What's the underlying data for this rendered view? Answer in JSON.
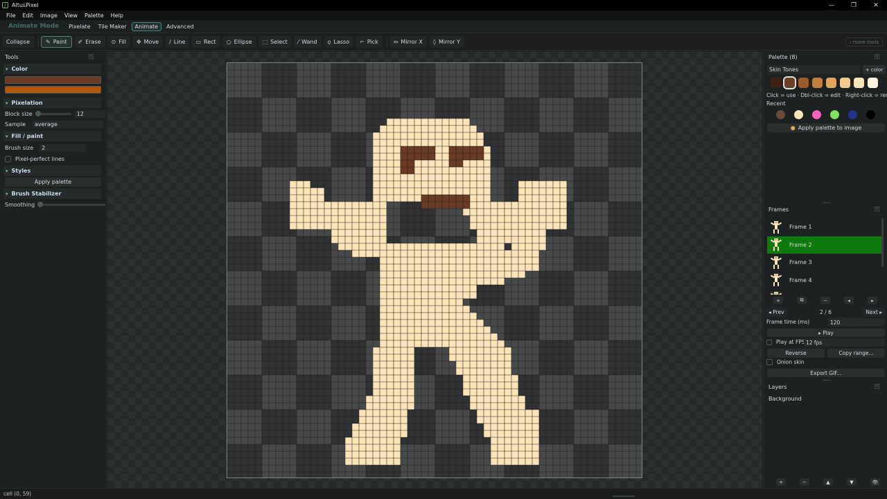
{
  "app": {
    "title": "AltusPixel",
    "icon": "app-logo-icon"
  },
  "window": {
    "minimize": "—",
    "restore": "❐",
    "close": "✕"
  },
  "menu": [
    "File",
    "Edit",
    "Image",
    "View",
    "Palette",
    "Help"
  ],
  "modebar": {
    "label": "Animate Mode",
    "tabs": [
      "Pixelate",
      "Tile Maker",
      "Animate",
      "Advanced"
    ],
    "active_tab": "Animate"
  },
  "toolbar": {
    "collapse": "Collapse",
    "tools": [
      {
        "label": "Paint",
        "icon": "✎"
      },
      {
        "label": "Erase",
        "icon": "✐"
      },
      {
        "label": "Fill",
        "icon": "⊙"
      },
      {
        "label": "Move",
        "icon": "✥"
      },
      {
        "label": "Line",
        "icon": "/"
      },
      {
        "label": "Rect",
        "icon": "▭"
      },
      {
        "label": "Ellipse",
        "icon": "○"
      },
      {
        "label": "Select",
        "icon": "⬚"
      },
      {
        "label": "Wand",
        "icon": "⁄"
      },
      {
        "label": "Lasso",
        "icon": "ϙ"
      },
      {
        "label": "Pick",
        "icon": "⌐"
      },
      {
        "label": "Mirror X",
        "icon": "⇔"
      },
      {
        "label": "Mirror Y",
        "icon": "◊"
      }
    ],
    "active_tool": "Paint",
    "more_tools": "› more tools"
  },
  "tools_panel": {
    "title": "Tools",
    "color_section": "Color",
    "primary_color": "#6b3a24",
    "secondary_color": "#b0570a",
    "pixelation_section": "Pixelation",
    "block_size_label": "Block size",
    "block_size_value": "12",
    "sample_label": "Sample",
    "sample_value": "average",
    "fill_section": "Fill / paint",
    "brush_size_label": "Brush size",
    "brush_size_value": "2",
    "pixel_perfect_label": "Pixel-perfect lines",
    "pixel_perfect_checked": false,
    "styles_section": "Styles",
    "apply_palette": "Apply palette",
    "stabilizer_section": "Brush Stabilizer",
    "smoothing_label": "Smoothing"
  },
  "palette_panel": {
    "title": "Palette (8)",
    "palette_name": "Skin Tones",
    "add_color": "+ color",
    "swatches": [
      "#3b2215",
      "#6b3f28",
      "#9c5a26",
      "#c07f3e",
      "#e0a55e",
      "#f2c98e",
      "#fde3b8",
      "#fff3e2"
    ],
    "selected_swatch": 1,
    "hint": "Click = use · Dbl-click = edit · Right-click = remove",
    "recent_label": "Recent",
    "recent": [
      "#6b4a3a",
      "#fde3b8",
      "#ff5fbd",
      "#7ee35f",
      "#24348a",
      "#000000"
    ],
    "apply_to_image": "Apply palette to image"
  },
  "frames_panel": {
    "title": "Frames",
    "frames": [
      "Frame 1",
      "Frame 2",
      "Frame 3",
      "Frame 4"
    ],
    "active_frame": "Frame 2",
    "controls": [
      "+",
      "⧉",
      "−",
      "◂",
      "▸"
    ],
    "prev": "◂ Prev",
    "next": "Next ▸",
    "counter": "2 / 6",
    "frame_time_label": "Frame time (ms)",
    "frame_time_value": "120",
    "play": "▸ Play",
    "play_at_fps_label": "Play at FPS",
    "fps_value": "12 fps",
    "reverse": "Reverse",
    "copy_range": "Copy range...",
    "onion_skin_label": "Onion skin",
    "export_gif": "Export GIF..."
  },
  "layers_panel": {
    "title": "Layers",
    "layers": [
      "Background"
    ],
    "controls": [
      "+",
      "−",
      "▲",
      "▼",
      "👁"
    ]
  },
  "canvas": {
    "grid_cells": 60,
    "skin_color": "#fde3b8",
    "feature_color": "#6b3a24",
    "dark_tile": "#2f3132",
    "light_tile": "#464849",
    "grid_line": "#1f2122"
  },
  "status": {
    "text": "cell (0, 59)"
  }
}
